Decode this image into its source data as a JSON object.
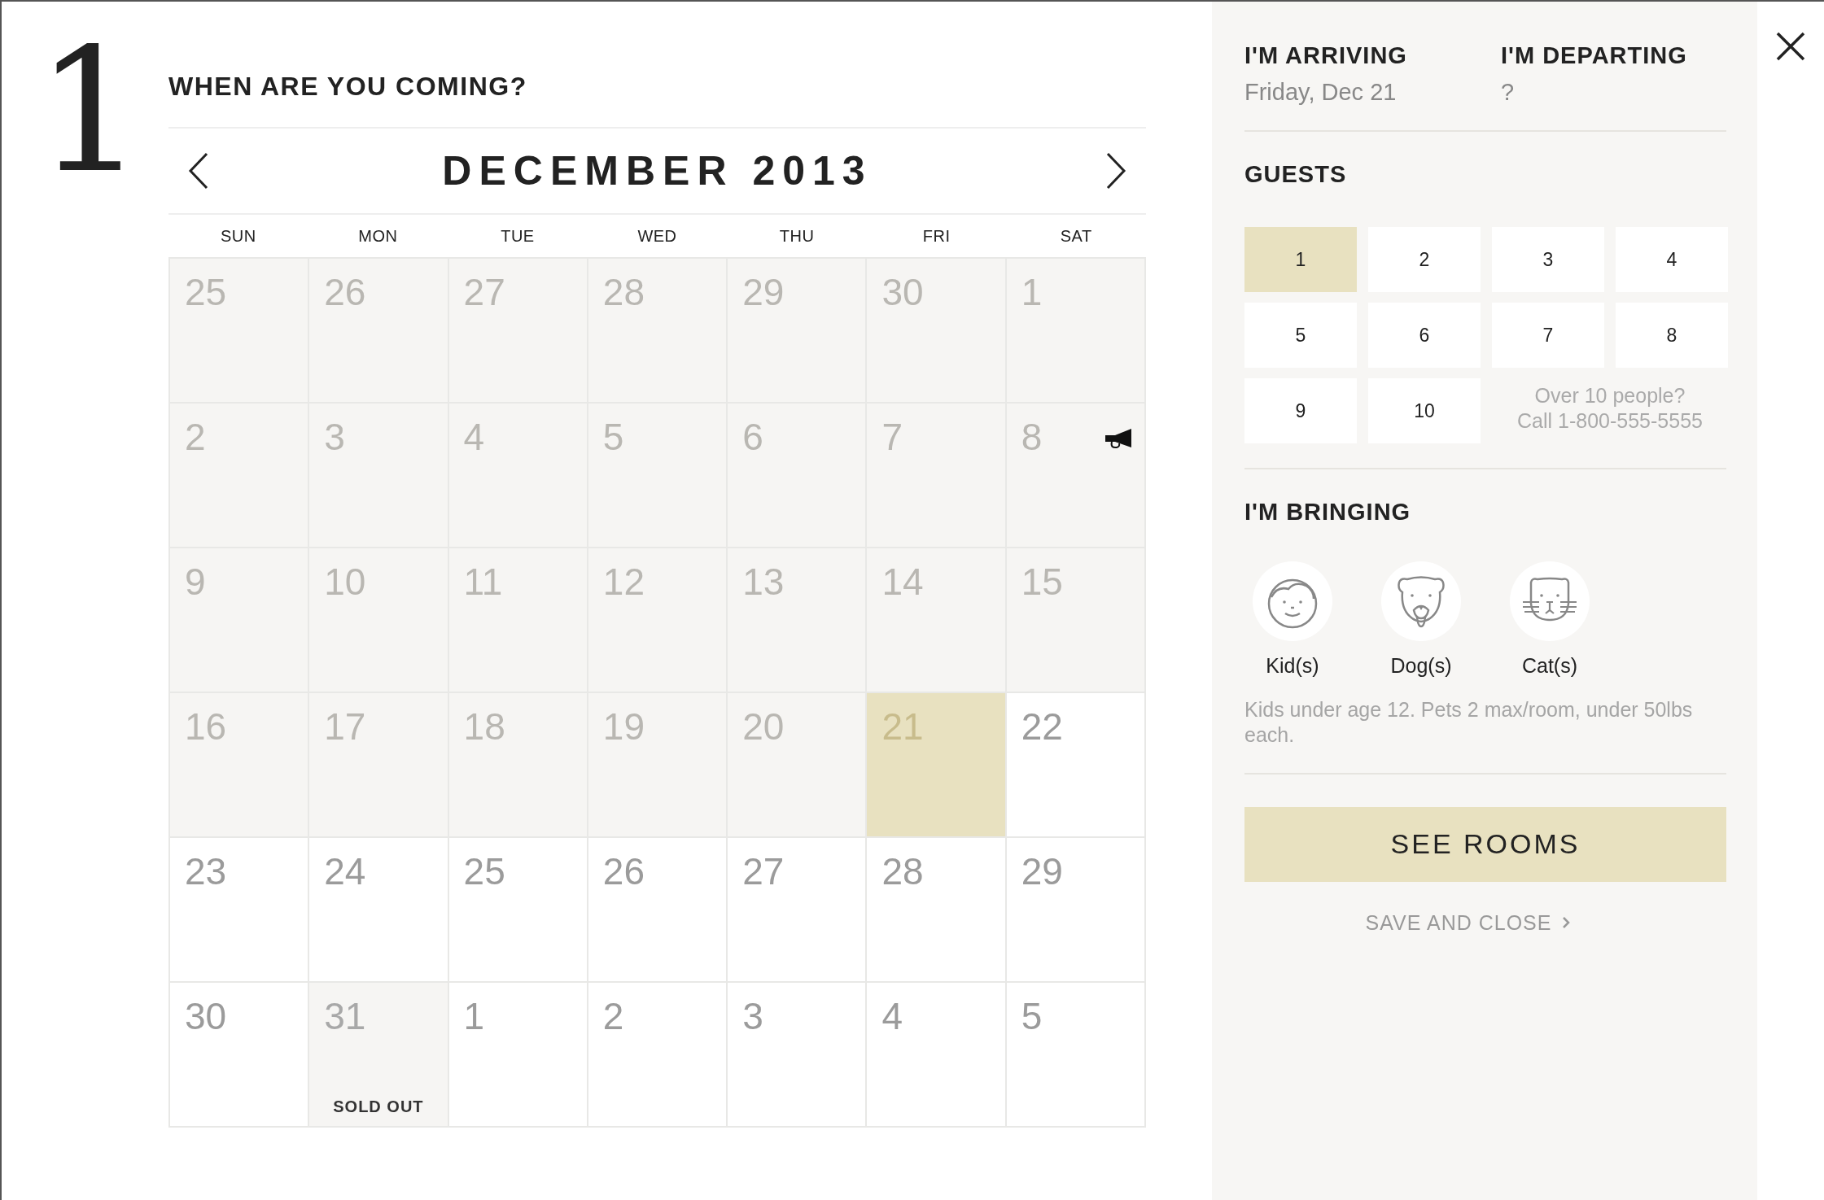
{
  "step": "1",
  "title": "WHEN ARE YOU COMING?",
  "calendar": {
    "month": "DECEMBER 2013",
    "weekdays": [
      "SUN",
      "MON",
      "TUE",
      "WED",
      "THU",
      "FRI",
      "SAT"
    ],
    "days": [
      {
        "day": "25",
        "kind": "past",
        "selected": false,
        "promo": false
      },
      {
        "day": "26",
        "kind": "past",
        "selected": false,
        "promo": false
      },
      {
        "day": "27",
        "kind": "past",
        "selected": false,
        "promo": false
      },
      {
        "day": "28",
        "kind": "past",
        "selected": false,
        "promo": false
      },
      {
        "day": "29",
        "kind": "past",
        "selected": false,
        "promo": false
      },
      {
        "day": "30",
        "kind": "past",
        "selected": false,
        "promo": false
      },
      {
        "day": "1",
        "kind": "past",
        "selected": false,
        "promo": false
      },
      {
        "day": "2",
        "kind": "past",
        "selected": false,
        "promo": false
      },
      {
        "day": "3",
        "kind": "past",
        "selected": false,
        "promo": false
      },
      {
        "day": "4",
        "kind": "past",
        "selected": false,
        "promo": false
      },
      {
        "day": "5",
        "kind": "past",
        "selected": false,
        "promo": false
      },
      {
        "day": "6",
        "kind": "past",
        "selected": false,
        "promo": false
      },
      {
        "day": "7",
        "kind": "past",
        "selected": false,
        "promo": false
      },
      {
        "day": "8",
        "kind": "past",
        "selected": false,
        "promo": true
      },
      {
        "day": "9",
        "kind": "past",
        "selected": false,
        "promo": false
      },
      {
        "day": "10",
        "kind": "past",
        "selected": false,
        "promo": false
      },
      {
        "day": "11",
        "kind": "past",
        "selected": false,
        "promo": false
      },
      {
        "day": "12",
        "kind": "past",
        "selected": false,
        "promo": false
      },
      {
        "day": "13",
        "kind": "past",
        "selected": false,
        "promo": false
      },
      {
        "day": "14",
        "kind": "past",
        "selected": false,
        "promo": false
      },
      {
        "day": "15",
        "kind": "past",
        "selected": false,
        "promo": false
      },
      {
        "day": "16",
        "kind": "past",
        "selected": false,
        "promo": false
      },
      {
        "day": "17",
        "kind": "past",
        "selected": false,
        "promo": false
      },
      {
        "day": "18",
        "kind": "past",
        "selected": false,
        "promo": false
      },
      {
        "day": "19",
        "kind": "past",
        "selected": false,
        "promo": false
      },
      {
        "day": "20",
        "kind": "past",
        "selected": false,
        "promo": false
      },
      {
        "day": "21",
        "kind": "open",
        "selected": true,
        "promo": false
      },
      {
        "day": "22",
        "kind": "open",
        "selected": false,
        "promo": false
      },
      {
        "day": "23",
        "kind": "open",
        "selected": false,
        "promo": false
      },
      {
        "day": "24",
        "kind": "open",
        "selected": false,
        "promo": false
      },
      {
        "day": "25",
        "kind": "open",
        "selected": false,
        "promo": false
      },
      {
        "day": "26",
        "kind": "open",
        "selected": false,
        "promo": false
      },
      {
        "day": "27",
        "kind": "open",
        "selected": false,
        "promo": false
      },
      {
        "day": "28",
        "kind": "open",
        "selected": false,
        "promo": false
      },
      {
        "day": "29",
        "kind": "open",
        "selected": false,
        "promo": false
      },
      {
        "day": "30",
        "kind": "open",
        "selected": false,
        "promo": false
      },
      {
        "day": "31",
        "kind": "soldout",
        "selected": false,
        "promo": false,
        "note": "SOLD OUT"
      },
      {
        "day": "1",
        "kind": "open",
        "selected": false,
        "promo": false
      },
      {
        "day": "2",
        "kind": "open",
        "selected": false,
        "promo": false
      },
      {
        "day": "3",
        "kind": "open",
        "selected": false,
        "promo": false
      },
      {
        "day": "4",
        "kind": "open",
        "selected": false,
        "promo": false
      },
      {
        "day": "5",
        "kind": "open",
        "selected": false,
        "promo": false
      }
    ]
  },
  "booking": {
    "arriving": {
      "label": "I'M ARRIVING",
      "value": "Friday, Dec 21"
    },
    "departing": {
      "label": "I'M DEPARTING",
      "value": "?"
    },
    "guests": {
      "label": "GUESTS",
      "options": [
        {
          "label": "1",
          "selected": true
        },
        {
          "label": "2",
          "selected": false
        },
        {
          "label": "3",
          "selected": false
        },
        {
          "label": "4",
          "selected": false
        },
        {
          "label": "5",
          "selected": false
        },
        {
          "label": "6",
          "selected": false
        },
        {
          "label": "7",
          "selected": false
        },
        {
          "label": "8",
          "selected": false
        },
        {
          "label": "9",
          "selected": false
        },
        {
          "label": "10",
          "selected": false
        }
      ],
      "note": "Over 10 people?\nCall  1-800-555-5555"
    },
    "bringing": {
      "label": "I'M BRINGING",
      "options": [
        {
          "kind": "kid",
          "label": "Kid(s)"
        },
        {
          "kind": "dog",
          "label": "Dog(s)"
        },
        {
          "kind": "cat",
          "label": "Cat(s)"
        }
      ],
      "note": "Kids under age 12. Pets 2 max/room, under 50lbs each."
    },
    "primary_button": "SEE ROOMS",
    "secondary_link": "SAVE AND CLOSE"
  }
}
